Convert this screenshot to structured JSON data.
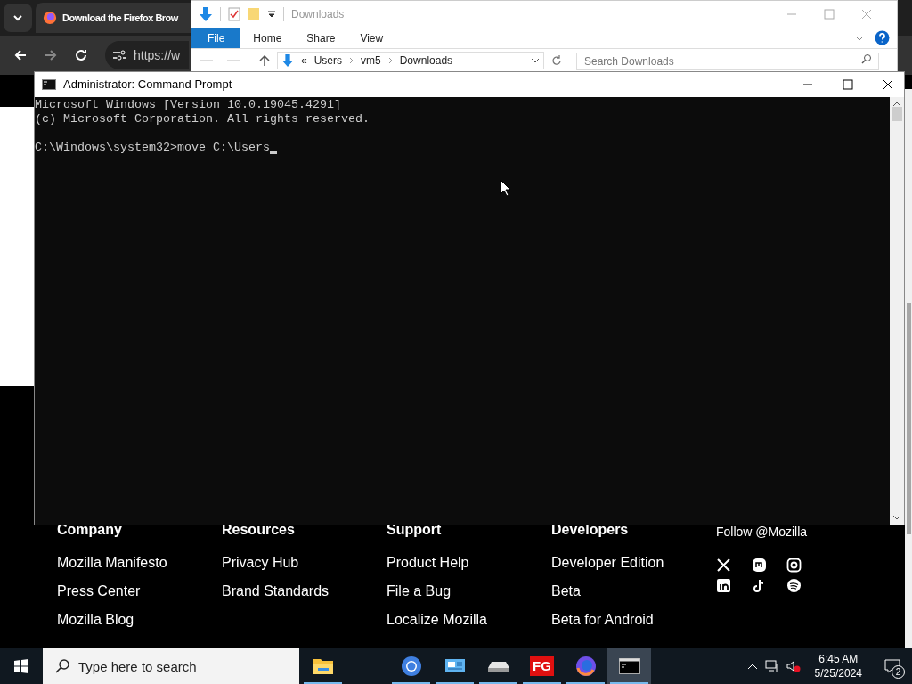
{
  "browser": {
    "tab_title": "Download the Firefox Brow",
    "url": "https://w",
    "footer": {
      "columns": [
        {
          "heading": "Company",
          "links": [
            "Mozilla Manifesto",
            "Press Center",
            "Mozilla Blog"
          ]
        },
        {
          "heading": "Resources",
          "links": [
            "Privacy Hub",
            "Brand Standards"
          ]
        },
        {
          "heading": "Support",
          "links": [
            "Product Help",
            "File a Bug",
            "Localize Mozilla"
          ]
        },
        {
          "heading": "Developers",
          "links": [
            "Developer Edition",
            "Beta",
            "Beta for Android"
          ]
        }
      ],
      "follow": "Follow @Mozilla"
    }
  },
  "explorer": {
    "title": "Downloads",
    "ribbon_tabs": [
      {
        "label": "File",
        "selected": true
      },
      {
        "label": "Home",
        "selected": false
      },
      {
        "label": "Share",
        "selected": false
      },
      {
        "label": "View",
        "selected": false
      }
    ],
    "breadcrumb_overflow": "«",
    "breadcrumb": [
      "Users",
      "vm5",
      "Downloads"
    ],
    "search": {
      "placeholder": "Search Downloads"
    }
  },
  "cmd": {
    "title": "Administrator: Command Prompt",
    "output": [
      "Microsoft Windows [Version 10.0.19045.4291]",
      "(c) Microsoft Corporation. All rights reserved."
    ],
    "prompt": "C:\\Windows\\system32>",
    "input": "move C:\\Users"
  },
  "taskbar": {
    "search": {
      "placeholder": "Type here to search"
    },
    "apps": [
      {
        "kind": "folder",
        "running": true,
        "selected": false
      },
      {
        "kind": "chrome",
        "running": true,
        "selected": false
      },
      {
        "kind": "monitor",
        "running": true,
        "selected": false
      },
      {
        "kind": "drive",
        "running": true,
        "selected": false
      },
      {
        "kind": "text",
        "label": "FG",
        "running": true,
        "selected": false
      },
      {
        "kind": "firefox",
        "running": true,
        "selected": false
      },
      {
        "kind": "terminal",
        "running": true,
        "selected": true
      }
    ],
    "time": "6:45 AM",
    "date": "5/25/2024",
    "notifications": "2"
  }
}
